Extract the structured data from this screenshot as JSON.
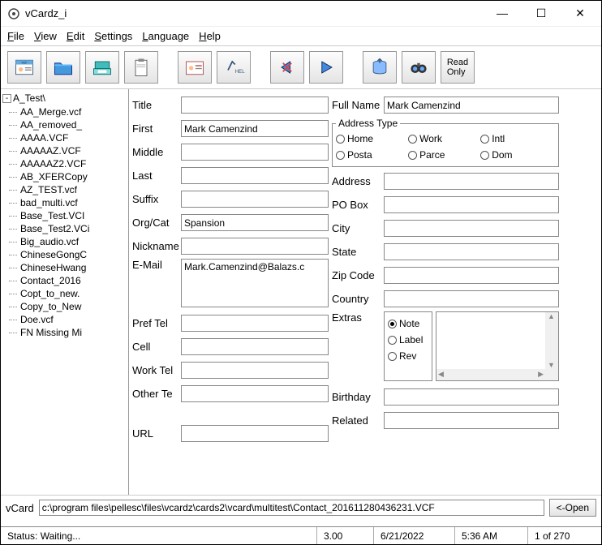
{
  "window": {
    "title": "vCardz_i"
  },
  "menu": {
    "file": "File",
    "view": "View",
    "edit": "Edit",
    "settings": "Settings",
    "language": "Language",
    "help": "Help"
  },
  "toolbar": {
    "readonly": "Read\nOnly"
  },
  "tree": {
    "root": "A_Test\\",
    "items": [
      "AA_Merge.vcf",
      "AA_removed_",
      "AAAA.VCF",
      "AAAAAZ.VCF",
      "AAAAAZ2.VCF",
      "AB_XFERCopy",
      "AZ_TEST.vcf",
      "bad_multi.vcf",
      "Base_Test.VCI",
      "Base_Test2.VCi",
      "Big_audio.vcf",
      "ChineseGongC",
      "ChineseHwang",
      "Contact_2016",
      "Copt_to_new.",
      "Copy_to_New",
      "Doe.vcf",
      "FN Missing Mi"
    ]
  },
  "labels": {
    "title": "Title",
    "first": "First",
    "middle": "Middle",
    "last": "Last",
    "suffix": "Suffix",
    "orgcat": "Org/Cat",
    "nickname": "Nickname",
    "email": "E-Mail",
    "preftel": "Pref Tel",
    "cell": "Cell",
    "worktel": "Work Tel",
    "othertel": "Other Te",
    "url": "URL",
    "fullname": "Full Name",
    "addresstype": "Address Type",
    "address": "Address",
    "pobox": "PO Box",
    "city": "City",
    "state": "State",
    "zip": "Zip Code",
    "country": "Country",
    "extras": "Extras",
    "birthday": "Birthday",
    "related": "Related"
  },
  "addresstype": {
    "home": "Home",
    "work": "Work",
    "intl": "Intl",
    "postal": "Posta",
    "parcel": "Parce",
    "dom": "Dom"
  },
  "extrastype": {
    "note": "Note",
    "label": "Label",
    "rev": "Rev"
  },
  "fields": {
    "title": "",
    "first": "Mark Camenzind",
    "middle": "",
    "last": "",
    "suffix": "",
    "orgcat": "Spansion",
    "nickname": "",
    "email": "Mark.Camenzind@Balazs.c",
    "preftel": "",
    "cell": "",
    "worktel": "",
    "othertel": "",
    "url": "",
    "fullname": "Mark Camenzind",
    "address": "",
    "pobox": "",
    "city": "",
    "state": "",
    "zip": "",
    "country": "",
    "birthday": "",
    "related": ""
  },
  "vcard": {
    "label": "vCard",
    "path": "c:\\program files\\pellesc\\files\\vcardz\\cards2\\vcard\\multitest\\Contact_201611280436231.VCF",
    "open": "<-Open"
  },
  "status": {
    "text": "Status: Waiting...",
    "ver": "3.00",
    "date": "6/21/2022",
    "time": "5:36 AM",
    "count": "1 of 270"
  }
}
